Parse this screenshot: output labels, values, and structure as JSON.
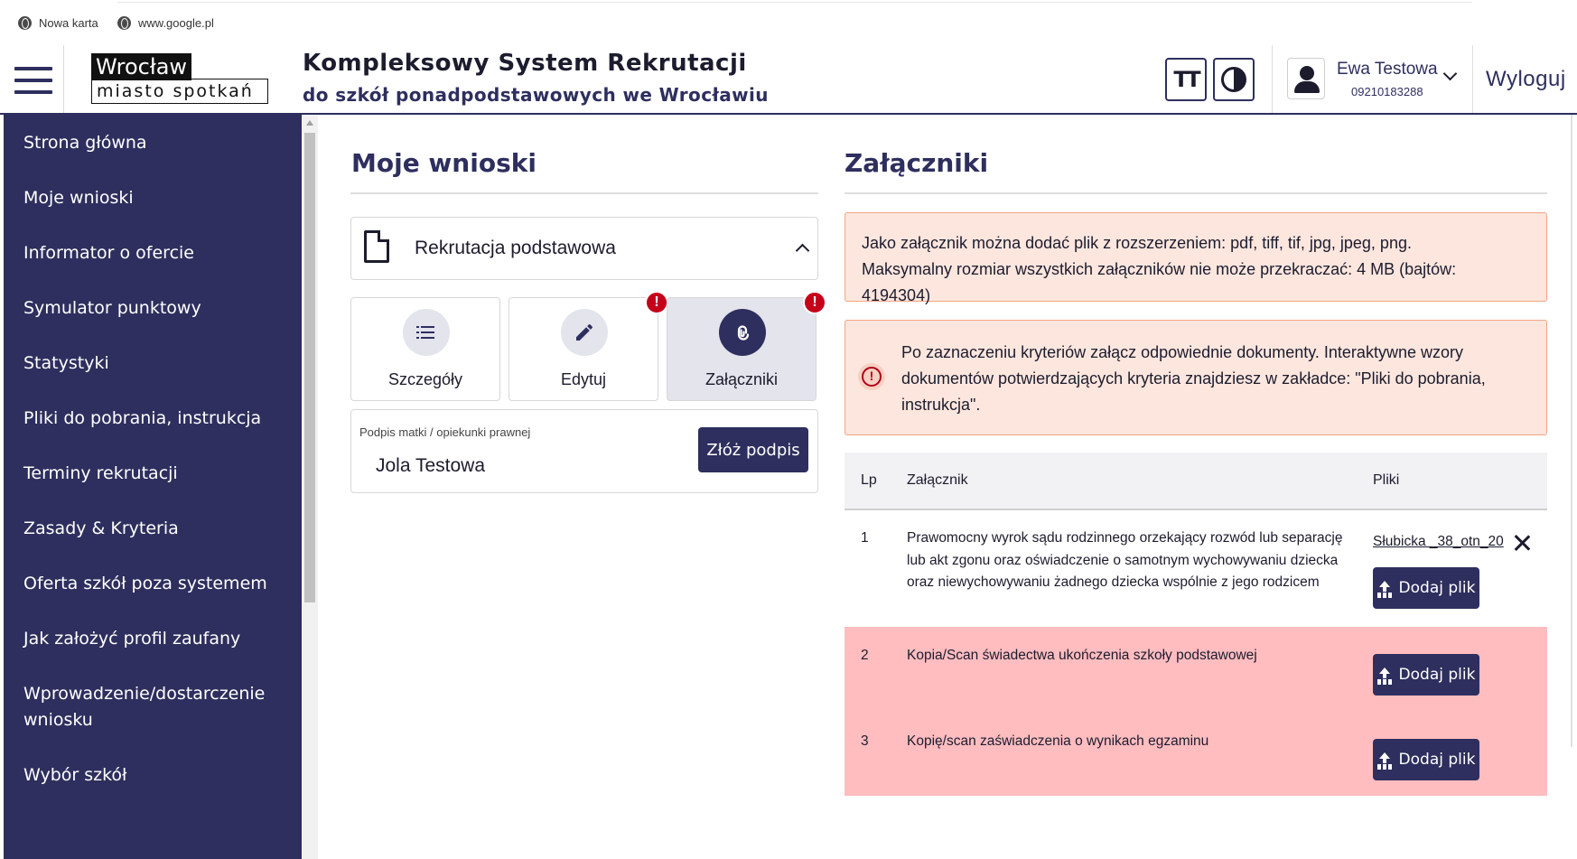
{
  "browser": {
    "bookmarks": [
      "Nowa karta",
      "www.google.pl"
    ]
  },
  "header": {
    "logo_line1": "Wrocław",
    "logo_line2": "miasto spotkań",
    "title": "Kompleksowy System Rekrutacji",
    "subtitle": "do szkół ponadpodstawowych we Wrocławiu",
    "font_size_btn": "TT",
    "user_name": "Ewa Testowa",
    "user_number": "09210183288",
    "logout": "Wyloguj"
  },
  "sidebar": {
    "items": [
      "Strona główna",
      "Moje wnioski",
      "Informator o ofercie",
      "Symulator punktowy",
      "Statystyki",
      "Pliki do pobrania, instrukcja",
      "Terminy rekrutacji",
      "Zasady & Kryteria",
      "Oferta szkół poza systemem",
      "Jak założyć profil zaufany",
      "Wprowadzenie/dostarczenie wniosku",
      "Wybór szkół"
    ]
  },
  "applications": {
    "title": "Moje wnioski",
    "accordion_label": "Rekrutacja podstawowa",
    "tiles": [
      {
        "label": "Szczegóły",
        "alert": false
      },
      {
        "label": "Edytuj",
        "alert": true
      },
      {
        "label": "Załączniki",
        "alert": true,
        "active": true
      }
    ],
    "alert_mark": "!",
    "signature": {
      "label": "Podpis matki / opiekunki prawnej",
      "value": "Jola Testowa",
      "button": "Złóż podpis"
    }
  },
  "attachments": {
    "title": "Załączniki",
    "info_notice": "Jako załącznik można dodać plik z rozszerzeniem: pdf, tiff, tif, jpg, jpeg, png. Maksymalny rozmiar wszystkich załączników nie może przekraczać: 4 MB (bajtów: 4194304)",
    "warning_notice": "Po zaznaczeniu kryteriów załącz odpowiednie dokumenty. Interaktywne wzory dokumentów potwierdzających kryteria znajdziesz w zakładce: \"Pliki do pobrania, instrukcja\".",
    "warning_mark": "!",
    "columns": {
      "lp": "Lp",
      "name": "Załącznik",
      "files": "Pliki"
    },
    "rows": [
      {
        "lp": "1",
        "name": "Prawomocny wyrok sądu rodzinnego orzekający rozwód lub separację lub akt zgonu oraz oświadczenie o samotnym wychowywaniu dziecka oraz niewychowywaniu żadnego dziecka wspólnie z jego rodzicem",
        "file": "Słubicka _38_otn_20",
        "status": "ok"
      },
      {
        "lp": "2",
        "name": "Kopia/Scan świadectwa ukończenia szkoły podstawowej",
        "file": "",
        "status": "missing"
      },
      {
        "lp": "3",
        "name": "Kopię/scan zaświadczenia o wynikach egzaminu",
        "file": "",
        "status": "missing"
      }
    ],
    "add_file": "Dodaj plik"
  },
  "colors": {
    "brand": "#2e2f5e",
    "alert": "#c5001a",
    "notice_bg": "#fde6de",
    "missing_row_bg": "#ffbdc0"
  }
}
